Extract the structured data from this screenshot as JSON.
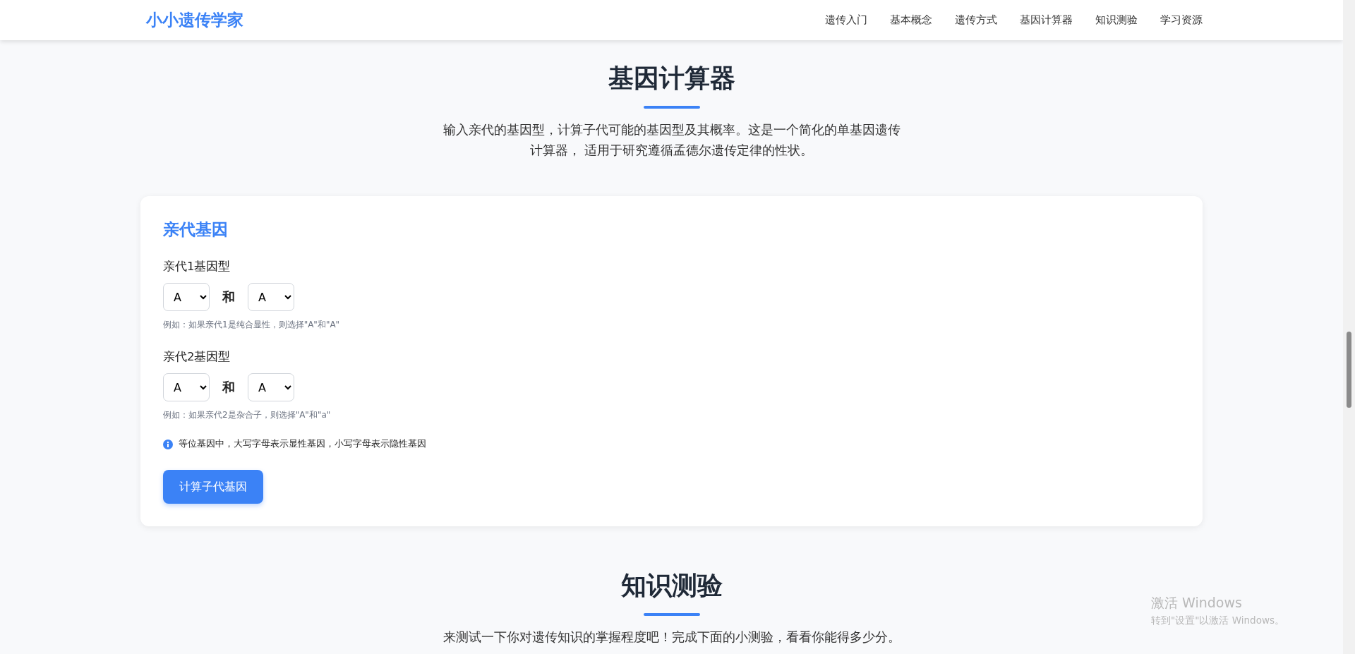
{
  "header": {
    "logo": "小小遗传学家",
    "nav": [
      {
        "label": "遗传入门"
      },
      {
        "label": "基本概念"
      },
      {
        "label": "遗传方式"
      },
      {
        "label": "基因计算器"
      },
      {
        "label": "知识测验"
      },
      {
        "label": "学习资源"
      }
    ]
  },
  "calculator": {
    "title": "基因计算器",
    "description": "输入亲代的基因型，计算子代可能的基因型及其概率。这是一个简化的单基因遗传计算器， 适用于研究遵循孟德尔遗传定律的性状。",
    "card": {
      "heading": "亲代基因",
      "parents": [
        {
          "label": "亲代1基因型",
          "alleles": [
            "A",
            "A"
          ],
          "connector": "和",
          "hint": "例如：如果亲代1是纯合显性，则选择\"A\"和\"A\""
        },
        {
          "label": "亲代2基因型",
          "alleles": [
            "A",
            "A"
          ],
          "connector": "和",
          "hint": "例如：如果亲代2是杂合子，则选择\"A\"和\"a\""
        }
      ],
      "info": "等位基因中，大写字母表示显性基因，小写字母表示隐性基因",
      "button": "计算子代基因"
    }
  },
  "quiz": {
    "title": "知识测验",
    "description": "来测试一下你对遗传知识的掌握程度吧！完成下面的小测验，看看你能得多少分。"
  },
  "os_overlay": {
    "title": "激活 Windows",
    "subtitle": "转到\"设置\"以激活 Windows。"
  }
}
